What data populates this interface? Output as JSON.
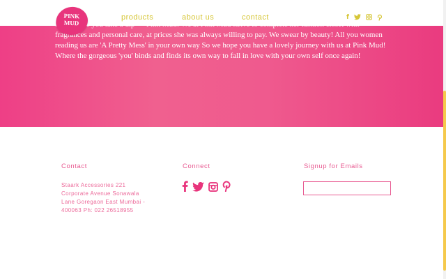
{
  "about": {
    "text": "Isn't it time you take a dip — Pink Mud! We at Pink Mud strive to complete her fashion closet with fragrances and personal care, at prices she was always willing to pay. We swear by beauty! All you women reading us are 'A Pretty Mess' in your own way So we hope you have a lovely journey with us at Pink Mud! Where the gorgeous 'you' binds and finds its own way to fall in love with your own self once again!"
  },
  "nav": {
    "logo_text": "PINK MUD",
    "links": [
      "products",
      "about us",
      "contact"
    ],
    "social_icons": [
      "facebook-icon",
      "twitter-icon",
      "instagram-icon",
      "pinterest-icon"
    ]
  },
  "footer": {
    "contact_title": "Contact",
    "address": "Staark Accessories 221 Corporate Avenue Sonawala Lane Goregaon East Mumbai - 400063 Ph: 022 26518955",
    "connect_title": "Connect",
    "social_icons": [
      "facebook-icon",
      "twitter-icon",
      "instagram-icon",
      "pinterest-icon"
    ],
    "signup_title": "Signup for Emails",
    "email_placeholder": ""
  },
  "colors": {
    "brand_pink": "#e8347c",
    "nav_link": "#d6c637",
    "footer_text": "#e85a91",
    "scroll_thumb": "#f5c94c"
  }
}
